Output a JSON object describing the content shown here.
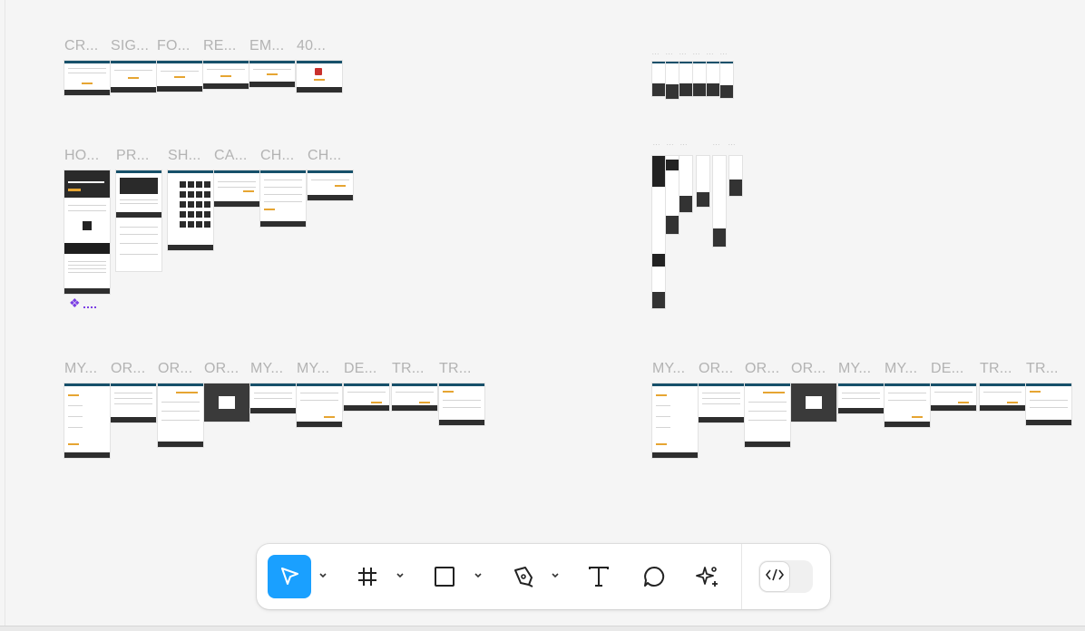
{
  "canvas": {
    "rows_left": [
      [
        "CR...",
        "SIG...",
        "FO...",
        "RE...",
        "EM...",
        "40..."
      ],
      [
        "HO...",
        "PR...",
        "SH...",
        "CA...",
        "CH...",
        "CH..."
      ],
      [
        "MY...",
        "OR...",
        "OR...",
        "OR...",
        "MY...",
        "MY...",
        "DE...",
        "TR...",
        "TR..."
      ]
    ],
    "rows_right": [
      [
        "MY...",
        "OR...",
        "OR...",
        "OR...",
        "MY...",
        "MY...",
        "DE...",
        "TR...",
        "TR..."
      ]
    ],
    "small_labels": [
      "...",
      "...",
      "...",
      "...",
      "...",
      "...",
      "...",
      "...",
      "...",
      "...",
      "..."
    ],
    "colors": {
      "header": "#16506a",
      "accent": "#e6a532",
      "footer": "#2e2e2e",
      "plugin": "#7b3fe4"
    }
  },
  "toolbar": {
    "tools": [
      {
        "name": "move-tool",
        "icon": "cursor-arrow-icon",
        "active": true,
        "has_menu": true
      },
      {
        "name": "frame-tool",
        "icon": "frame-hash-icon",
        "active": false,
        "has_menu": true
      },
      {
        "name": "shape-tool",
        "icon": "rectangle-icon",
        "active": false,
        "has_menu": true
      },
      {
        "name": "pen-tool",
        "icon": "pen-nib-icon",
        "active": false,
        "has_menu": true
      },
      {
        "name": "text-tool",
        "icon": "text-T-icon",
        "active": false,
        "has_menu": false
      },
      {
        "name": "comment-tool",
        "icon": "speech-bubble-icon",
        "active": false,
        "has_menu": false
      },
      {
        "name": "ai-tool",
        "icon": "sparkle-plus-icon",
        "active": false,
        "has_menu": false
      }
    ],
    "dev_mode": {
      "icon": "code-brackets-icon",
      "enabled": false
    },
    "active_color": "#1aa0ff"
  }
}
